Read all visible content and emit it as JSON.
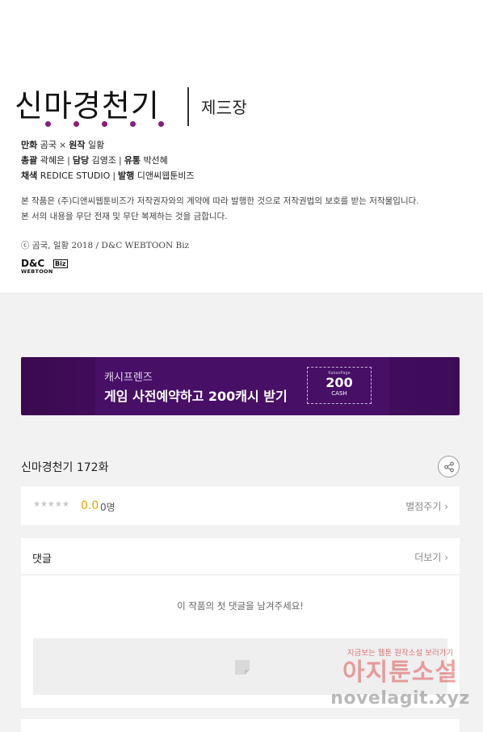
{
  "credits": {
    "title": "신마경천기",
    "subtitle": "제三장",
    "staff": [
      [
        {
          "role": "만화",
          "name": "곰국"
        },
        {
          "sep": "×"
        },
        {
          "role": "원작",
          "name": "일황"
        }
      ],
      [
        {
          "role": "총괄",
          "name": "곽혜은"
        },
        {
          "sep": "|"
        },
        {
          "role": "담당",
          "name": "김영조"
        },
        {
          "sep": "|"
        },
        {
          "role": "유통",
          "name": "박선혜"
        }
      ],
      [
        {
          "role": "채색",
          "name": "REDICE STUDIO"
        },
        {
          "sep": "|"
        },
        {
          "role": "발행",
          "name": "디앤씨웹툰비즈"
        }
      ]
    ],
    "notice_line1": "본 작품은 (주)디앤씨웹툰비즈가 저작권자와의 계약에 따라 발행한 것으로 저작권법의 보호를 받는 저작물입니다.",
    "notice_line2": "본 서의 내용을 무단 전재 및 무단 복제하는 것을 금합니다.",
    "copyright": "ⓒ 곰국, 일황 2018 / D&C WEBTOON Biz",
    "logo": {
      "top": "D&C",
      "badge": "Biz",
      "bottom": "WEBTOON"
    }
  },
  "banner": {
    "subtitle": "캐시프렌즈",
    "title": "게임 사전예약하고 200캐시 받기",
    "coupon_small": "KakaoPage",
    "coupon_amount": "200",
    "coupon_unit": "CASH",
    "accent": "#470f66"
  },
  "episode": {
    "title": "신마경천기 172화",
    "share_icon": "share-icon"
  },
  "rating": {
    "stars": "★★★★★",
    "score": "0.0",
    "count": "0명",
    "rate_link": "별점주기 ›",
    "score_color": "#e6a400"
  },
  "comments": {
    "title": "댓글",
    "more_link": "더보기 ›",
    "empty_message": "이 작품의 첫 댓글을 남겨주세요!"
  },
  "watermark": {
    "top": "지금보는 웹툰 원작소설 보러가기",
    "mid": "아지툰소설",
    "bottom": "novelagit.xyz"
  }
}
